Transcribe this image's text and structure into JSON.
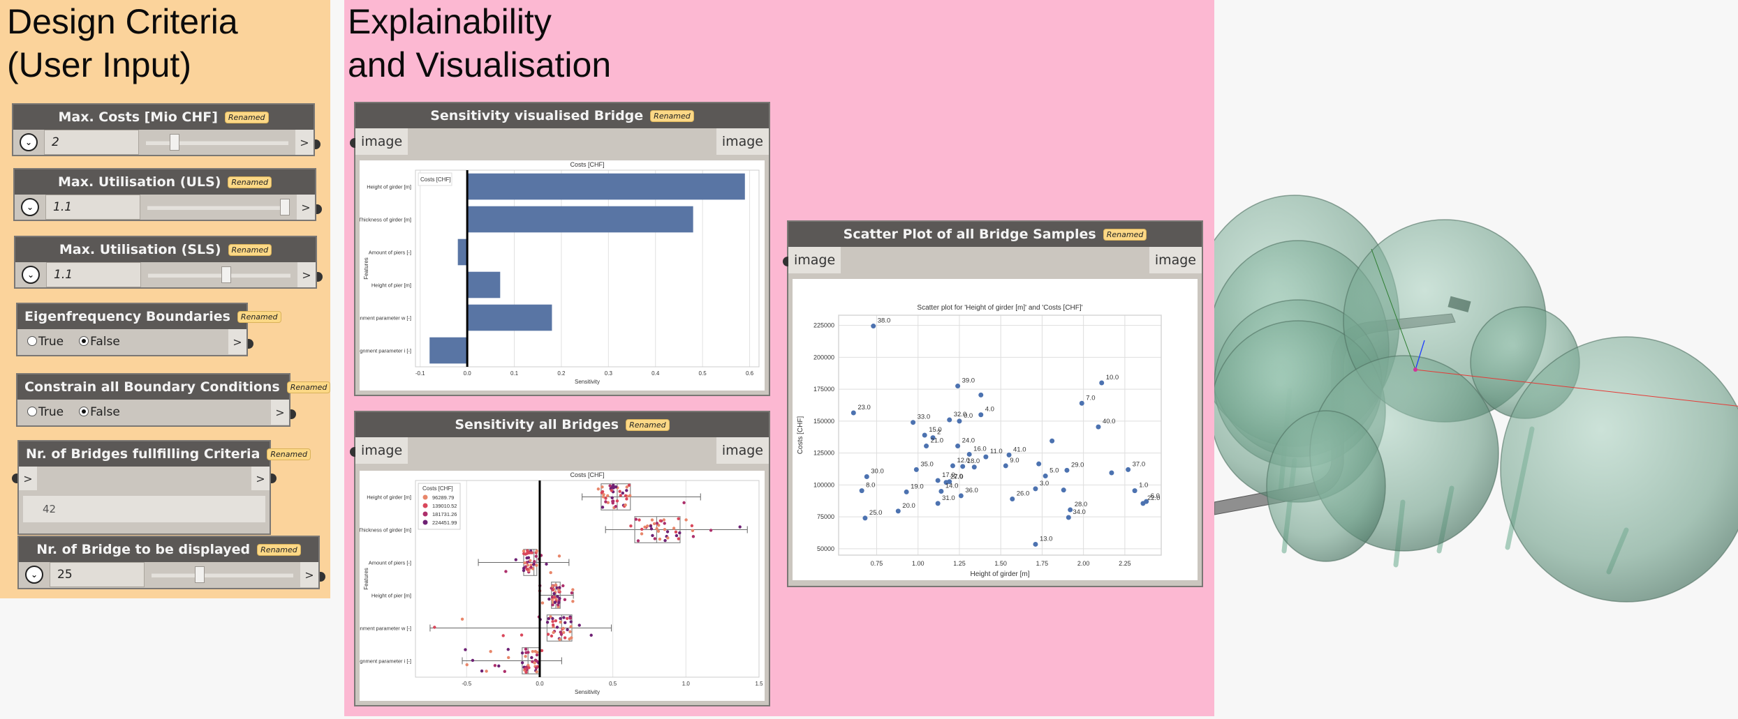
{
  "groups": {
    "design": {
      "title": "Design Criteria\n(User Input)",
      "color": "#fbd39b"
    },
    "explain": {
      "title": "Explainability\nand Visualisation",
      "color": "#fcb8d2"
    }
  },
  "badge_label": "Renamed",
  "inputs": {
    "max_costs": {
      "title": "Max. Costs [Mio CHF]",
      "value": "2",
      "slider_fraction": 0.18,
      "output_arrow": ">"
    },
    "max_uls": {
      "title": "Max. Utilisation (ULS)",
      "value": "1.1",
      "slider_fraction": 1.0,
      "output_arrow": ">"
    },
    "max_sls": {
      "title": "Max. Utilisation (SLS)",
      "value": "1.1",
      "slider_fraction": 0.55,
      "output_arrow": ">"
    },
    "eigenfrequency": {
      "title": "Eigenfrequency Boundaries",
      "options": [
        "True",
        "False"
      ],
      "selected": "False",
      "output_arrow": ">"
    },
    "constrain_bc": {
      "title": "Constrain all Boundary Conditions",
      "options": [
        "True",
        "False"
      ],
      "selected": "False",
      "output_arrow": ">"
    },
    "nr_fulfilling": {
      "title": "Nr. of Bridges fullfilling Criteria",
      "input_arrow": ">",
      "output_arrow": ">",
      "value": "42"
    },
    "nr_displayed": {
      "title": "Nr. of Bridge to be displayed",
      "value": "25",
      "slider_fraction": 0.33,
      "output_arrow": ">"
    }
  },
  "watch_nodes": {
    "sensitivity_bridge": {
      "title": "Sensitivity visualised Bridge",
      "in_port": "image",
      "out_port": "image"
    },
    "sensitivity_all": {
      "title": "Sensitivity all Bridges",
      "in_port": "image",
      "out_port": "image"
    },
    "scatter": {
      "title": "Scatter Plot of all Bridge Samples",
      "in_port": "image",
      "out_port": "image"
    }
  },
  "chart_data": [
    {
      "type": "bar",
      "orientation": "horizontal",
      "title": "Costs [CHF]",
      "legend": {
        "title": "Costs [CHF]",
        "placement": "top-left"
      },
      "categories": [
        "Height of girder [m]",
        "Thickness of girder [m]",
        "Amount of piers [-]",
        "Height of pier [m]",
        "Alignment parameter w [-]",
        "Alignment parameter i [-]"
      ],
      "values": [
        0.59,
        0.48,
        -0.02,
        0.07,
        0.18,
        -0.08
      ],
      "xlabel": "Sensitivity",
      "ylabel": "Features",
      "xlim": [
        -0.11,
        0.62
      ],
      "xticks": [
        "-0.1",
        "0.0",
        "0.1",
        "0.2",
        "0.3",
        "0.4",
        "0.5",
        "0.6"
      ],
      "bar_color": "#5975a4",
      "grid": true
    },
    {
      "type": "box",
      "title": "Costs [CHF]",
      "categories": [
        "Height of girder [m]",
        "Thickness of girder [m]",
        "Amount of piers [-]",
        "Height of pier [m]",
        "Alignment parameter w [-]",
        "Alignment parameter i [-]"
      ],
      "boxes": [
        {
          "min": 0.29,
          "q1": 0.42,
          "median": 0.53,
          "q3": 0.62,
          "max": 1.1
        },
        {
          "min": 0.45,
          "q1": 0.65,
          "median": 0.8,
          "q3": 0.96,
          "max": 1.42
        },
        {
          "min": -0.42,
          "q1": -0.11,
          "median": -0.04,
          "q3": -0.02,
          "max": 0.2
        },
        {
          "min": 0.0,
          "q1": 0.08,
          "median": 0.11,
          "q3": 0.14,
          "max": 0.23
        },
        {
          "min": -0.75,
          "q1": 0.05,
          "median": 0.15,
          "q3": 0.22,
          "max": 0.49
        },
        {
          "min": -0.53,
          "q1": -0.12,
          "median": -0.08,
          "q3": 0.0,
          "max": 0.15
        }
      ],
      "xlabel": "Sensitivity",
      "ylabel": "Features",
      "xlim": [
        -0.85,
        1.5
      ],
      "xticks": [
        "-0.5",
        "0.0",
        "0.5",
        "1.0",
        "1.5"
      ],
      "legend": {
        "title": "Costs [CHF]",
        "placement": "top-left",
        "entries": [
          {
            "label": "96289.79",
            "color": "#e8866a"
          },
          {
            "label": "139010.52",
            "color": "#d9475b"
          },
          {
            "label": "181731.26",
            "color": "#ad2f6b"
          },
          {
            "label": "224451.99",
            "color": "#6e2174"
          }
        ]
      },
      "grid": true
    },
    {
      "type": "scatter",
      "title": "Scatter plot for 'Height of girder [m]' and 'Costs [CHF]'",
      "xlabel": "Height of girder [m]",
      "ylabel": "Costs [CHF]",
      "xlim": [
        0.52,
        2.47
      ],
      "ylim": [
        45000,
        233000
      ],
      "xticks": [
        "0.75",
        "1.00",
        "1.25",
        "1.50",
        "1.75",
        "2.00",
        "2.25"
      ],
      "yticks": [
        "50000",
        "75000",
        "100000",
        "125000",
        "150000",
        "175000",
        "200000",
        "225000"
      ],
      "point_color": "#4c72b0",
      "points": [
        {
          "x": 0.73,
          "y": 224500,
          "label": "38.0"
        },
        {
          "x": 0.61,
          "y": 156500,
          "label": "23.0"
        },
        {
          "x": 0.97,
          "y": 149000,
          "label": "33.0"
        },
        {
          "x": 1.24,
          "y": 177500,
          "label": "39.0"
        },
        {
          "x": 1.38,
          "y": 170500,
          "label": ""
        },
        {
          "x": 1.38,
          "y": 155000,
          "label": "4.0"
        },
        {
          "x": 1.19,
          "y": 151000,
          "label": "32.0"
        },
        {
          "x": 1.25,
          "y": 150000,
          "label": "0.0"
        },
        {
          "x": 1.04,
          "y": 139000,
          "label": "15.0"
        },
        {
          "x": 1.09,
          "y": 137000,
          "label": "2"
        },
        {
          "x": 1.05,
          "y": 130500,
          "label": "21.0"
        },
        {
          "x": 1.24,
          "y": 130500,
          "label": "24.0"
        },
        {
          "x": 1.31,
          "y": 124000,
          "label": "16.0"
        },
        {
          "x": 1.41,
          "y": 122000,
          "label": "11.0"
        },
        {
          "x": 1.55,
          "y": 123500,
          "label": "41.0"
        },
        {
          "x": 1.53,
          "y": 115000,
          "label": "9.0"
        },
        {
          "x": 1.21,
          "y": 115000,
          "label": "12.0"
        },
        {
          "x": 1.27,
          "y": 114500,
          "label": "18.0"
        },
        {
          "x": 1.34,
          "y": 114000,
          "label": ""
        },
        {
          "x": 0.99,
          "y": 112000,
          "label": "35.0"
        },
        {
          "x": 1.12,
          "y": 103500,
          "label": "17.0"
        },
        {
          "x": 1.17,
          "y": 102000,
          "label": "27.0"
        },
        {
          "x": 1.19,
          "y": 102500,
          "label": "2.0"
        },
        {
          "x": 1.14,
          "y": 95000,
          "label": "14.0"
        },
        {
          "x": 1.26,
          "y": 91500,
          "label": "36.0"
        },
        {
          "x": 1.12,
          "y": 85500,
          "label": "31.0"
        },
        {
          "x": 0.69,
          "y": 106500,
          "label": "30.0"
        },
        {
          "x": 0.66,
          "y": 95500,
          "label": "8.0"
        },
        {
          "x": 0.93,
          "y": 94500,
          "label": "19.0"
        },
        {
          "x": 0.88,
          "y": 79500,
          "label": "20.0"
        },
        {
          "x": 0.68,
          "y": 74000,
          "label": "25.0"
        },
        {
          "x": 1.57,
          "y": 89000,
          "label": "26.0"
        },
        {
          "x": 1.71,
          "y": 97000,
          "label": "3.0"
        },
        {
          "x": 1.73,
          "y": 116500,
          "label": ""
        },
        {
          "x": 1.77,
          "y": 107000,
          "label": "5.0"
        },
        {
          "x": 1.81,
          "y": 134500,
          "label": ""
        },
        {
          "x": 1.88,
          "y": 96000,
          "label": ""
        },
        {
          "x": 1.9,
          "y": 111500,
          "label": "29.0"
        },
        {
          "x": 1.92,
          "y": 80500,
          "label": "28.0"
        },
        {
          "x": 1.91,
          "y": 74500,
          "label": "34.0"
        },
        {
          "x": 1.71,
          "y": 53500,
          "label": "13.0"
        },
        {
          "x": 1.99,
          "y": 164000,
          "label": "7.0"
        },
        {
          "x": 2.11,
          "y": 180000,
          "label": "10.0"
        },
        {
          "x": 2.09,
          "y": 145500,
          "label": "40.0"
        },
        {
          "x": 2.17,
          "y": 109500,
          "label": ""
        },
        {
          "x": 2.27,
          "y": 112000,
          "label": "37.0"
        },
        {
          "x": 2.31,
          "y": 95500,
          "label": "1.0"
        },
        {
          "x": 2.36,
          "y": 85500,
          "label": "22.0"
        },
        {
          "x": 2.38,
          "y": 87000,
          "label": "6.0"
        }
      ],
      "grid": true
    }
  ],
  "viewport3d": {
    "description": "3D bridge model with transparent green constraint spheres",
    "sphere_color": "#7fb39b",
    "axis_colors": {
      "x": "#e53935",
      "y": "#2e7d32",
      "z": "#1e3cff"
    }
  }
}
